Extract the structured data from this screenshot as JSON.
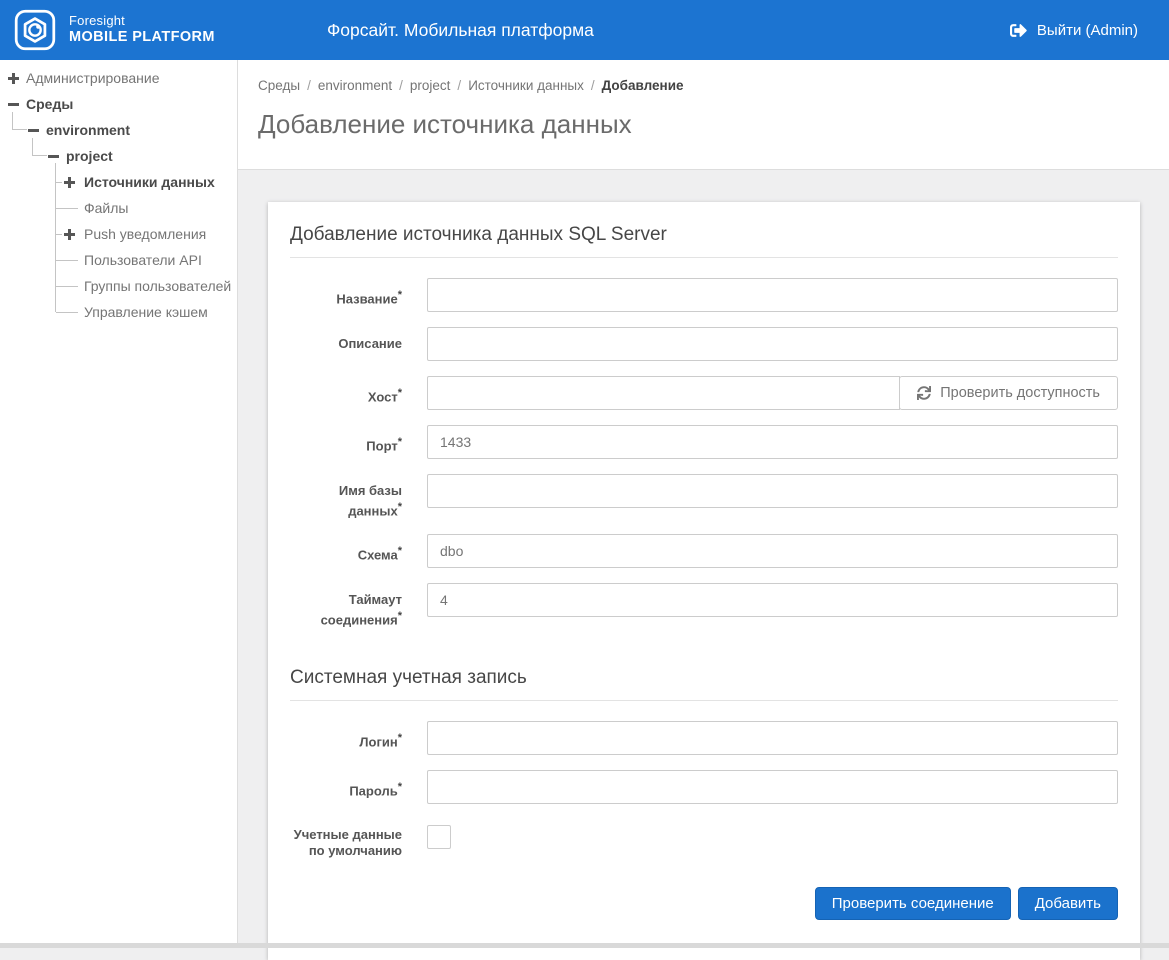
{
  "colors": {
    "header_blue": "#1c74d1",
    "button_blue": "#1b72cc",
    "background_gray": "#efeff0"
  },
  "header": {
    "logo_line1": "Foresight",
    "logo_line2": "MOBILE PLATFORM",
    "title": "Форсайт. Мобильная платформа",
    "logout_label": "Выйти (Admin)"
  },
  "sidebar": {
    "items": [
      {
        "label": "Администрирование",
        "icon": "plus",
        "level": 0,
        "emphasis": false
      },
      {
        "label": "Среды",
        "icon": "minus",
        "level": 0,
        "emphasis": true
      },
      {
        "label": "environment",
        "icon": "minus",
        "level": 1,
        "emphasis": true
      },
      {
        "label": "project",
        "icon": "minus",
        "level": 2,
        "emphasis": true
      },
      {
        "label": "Источники данных",
        "icon": "plus",
        "level": 3,
        "emphasis": true
      },
      {
        "label": "Файлы",
        "icon": "none",
        "level": 3,
        "emphasis": false
      },
      {
        "label": "Push уведомления",
        "icon": "plus",
        "level": 3,
        "emphasis": false
      },
      {
        "label": "Пользователи API",
        "icon": "none",
        "level": 3,
        "emphasis": false
      },
      {
        "label": "Группы пользователей",
        "icon": "none",
        "level": 3,
        "emphasis": false
      },
      {
        "label": "Управление кэшем",
        "icon": "none",
        "level": 3,
        "emphasis": false
      }
    ]
  },
  "breadcrumb": {
    "separator": "/",
    "items": [
      "Среды",
      "environment",
      "project",
      "Источники данных",
      "Добавление"
    ]
  },
  "page": {
    "title": "Добавление источника данных"
  },
  "form": {
    "section1_title": "Добавление источника данных SQL Server",
    "section2_title": "Системная учетная запись",
    "required_marker": "*",
    "fields": {
      "name": {
        "label": "Название",
        "value": ""
      },
      "description": {
        "label": "Описание",
        "value": ""
      },
      "host": {
        "label": "Хост",
        "value": "",
        "check_button_label": "Проверить доступность"
      },
      "port": {
        "label": "Порт",
        "value": "1433"
      },
      "database": {
        "label": "Имя базы данных",
        "value": ""
      },
      "schema": {
        "label": "Схема",
        "value": "dbo"
      },
      "timeout": {
        "label": "Таймаут соединения",
        "value": "4"
      },
      "login": {
        "label": "Логин",
        "value": ""
      },
      "password": {
        "label": "Пароль",
        "value": ""
      },
      "default_credentials": {
        "label": "Учетные данные по умолчанию",
        "checked": false
      }
    },
    "buttons": {
      "test_connection": "Проверить соединение",
      "add": "Добавить"
    }
  }
}
